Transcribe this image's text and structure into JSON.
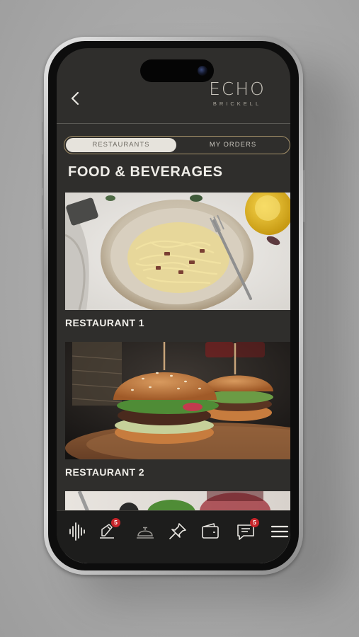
{
  "app": {
    "logo_main": "ECHO",
    "logo_sub": "BRICKELL"
  },
  "tabs": {
    "active": "RESTAURANTS",
    "inactive": "MY ORDERS"
  },
  "page": {
    "title": "FOOD & BEVERAGES"
  },
  "restaurants": [
    {
      "name": "RESTAURANT 1",
      "image": "pasta-plate"
    },
    {
      "name": "RESTAURANT 2",
      "image": "burgers"
    },
    {
      "name": "",
      "image": "salad-dish"
    }
  ],
  "nav": {
    "items": [
      {
        "name": "sound-wave-icon"
      },
      {
        "name": "edit-note-icon",
        "badge": "5"
      },
      {
        "name": "service-bell-icon"
      },
      {
        "name": "pin-icon"
      },
      {
        "name": "wallet-icon"
      },
      {
        "name": "chat-icon",
        "badge": "5"
      },
      {
        "name": "menu-icon"
      }
    ]
  },
  "colors": {
    "accent_gold": "#a4916a",
    "screen_bg": "#2f2e2c",
    "nav_bg": "#1d1d1c",
    "badge": "#c8252a"
  }
}
